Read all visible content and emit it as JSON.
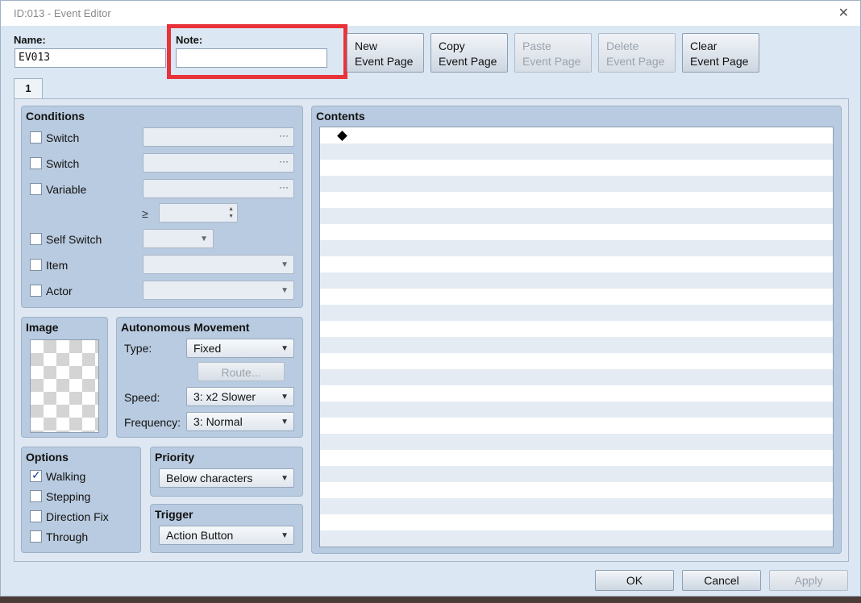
{
  "window": {
    "title": "ID:013 - Event Editor",
    "close_glyph": "✕"
  },
  "name": {
    "label": "Name:",
    "value": "EV013"
  },
  "note": {
    "label": "Note:",
    "value": ""
  },
  "toolbar": {
    "new": "New\nEvent Page",
    "copy": "Copy\nEvent Page",
    "paste": "Paste\nEvent Page",
    "delete": "Delete\nEvent Page",
    "clear": "Clear\nEvent Page"
  },
  "tabs": [
    {
      "label": "1"
    }
  ],
  "conditions": {
    "title": "Conditions",
    "items": [
      {
        "label": "Switch",
        "checked": false
      },
      {
        "label": "Switch",
        "checked": false
      },
      {
        "label": "Variable",
        "checked": false
      },
      {
        "label": "Self Switch",
        "checked": false
      },
      {
        "label": "Item",
        "checked": false
      },
      {
        "label": "Actor",
        "checked": false
      }
    ],
    "dots": "···",
    "ge": "≥"
  },
  "image": {
    "title": "Image"
  },
  "movement": {
    "title": "Autonomous Movement",
    "type_label": "Type:",
    "type_value": "Fixed",
    "route_button": "Route...",
    "speed_label": "Speed:",
    "speed_value": "3: x2 Slower",
    "frequency_label": "Frequency:",
    "frequency_value": "3: Normal"
  },
  "options": {
    "title": "Options",
    "items": [
      {
        "label": "Walking",
        "checked": true
      },
      {
        "label": "Stepping",
        "checked": false
      },
      {
        "label": "Direction Fix",
        "checked": false
      },
      {
        "label": "Through",
        "checked": false
      }
    ]
  },
  "priority": {
    "title": "Priority",
    "value": "Below characters"
  },
  "trigger": {
    "title": "Trigger",
    "value": "Action Button"
  },
  "contents": {
    "title": "Contents"
  },
  "footer": {
    "ok": "OK",
    "cancel": "Cancel",
    "apply": "Apply"
  },
  "icons": {
    "dropdown_arrow": "▼",
    "spin_up": "▲",
    "spin_down": "▼"
  },
  "colors": {
    "highlight": "#e8333a",
    "panel": "#b9cbe0",
    "window": "#dbe7f3"
  }
}
